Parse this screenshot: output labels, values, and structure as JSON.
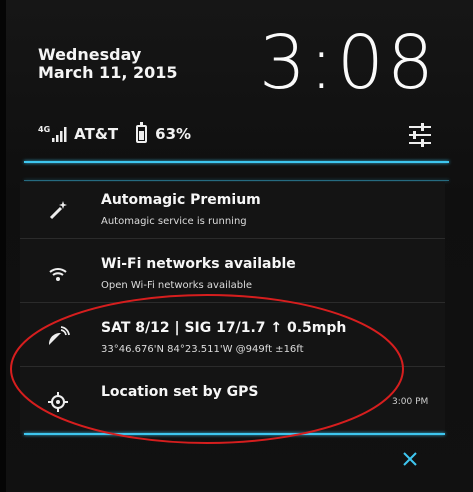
{
  "lockscreen": {
    "day": "Wednesday",
    "date": "March 11, 2015",
    "time": "3:08"
  },
  "status": {
    "network_type": "4G",
    "carrier": "AT&T",
    "battery": "63%"
  },
  "notifications": [
    {
      "icon": "wand-icon",
      "title": "Automagic Premium",
      "subtitle": "Automagic service is running"
    },
    {
      "icon": "wifi-icon",
      "title": "Wi-Fi networks available",
      "subtitle": "Open Wi-Fi networks available"
    },
    {
      "icon": "satellite-icon",
      "title": "SAT 8/12 | SIG 17/1.7 ↑ 0.5mph",
      "subtitle": "33°46.676'N 84°23.511'W @949ft ±16ft"
    },
    {
      "icon": "gps-target-icon",
      "title": "Location set by GPS",
      "subtitle": ""
    }
  ],
  "notification_time": "3:00 PM",
  "colors": {
    "accent": "#3ec6ef",
    "annotation": "#d61e1e"
  }
}
